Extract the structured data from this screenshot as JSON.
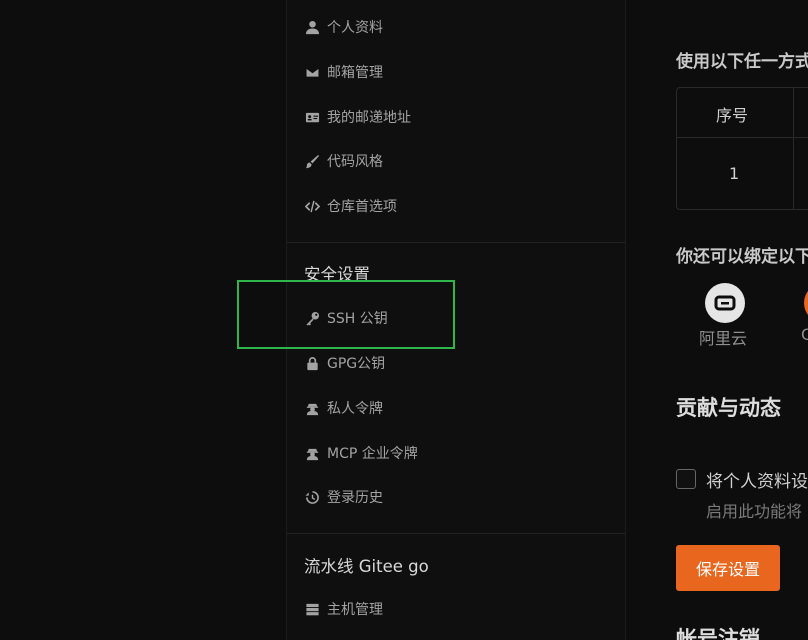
{
  "sidebar": {
    "items_top": [
      {
        "label": "个人资料",
        "icon": "user-icon"
      },
      {
        "label": "邮箱管理",
        "icon": "envelope-icon"
      },
      {
        "label": "我的邮递地址",
        "icon": "address-card-icon"
      },
      {
        "label": "代码风格",
        "icon": "brush-icon"
      },
      {
        "label": "仓库首选项",
        "icon": "code-icon"
      }
    ],
    "security_title": "安全设置",
    "items_security": [
      {
        "label": "SSH 公钥",
        "icon": "key-icon"
      },
      {
        "label": "GPG公钥",
        "icon": "lock-icon"
      },
      {
        "label": "私人令牌",
        "icon": "user-secret-icon"
      },
      {
        "label": "MCP 企业令牌",
        "icon": "user-secret-icon"
      },
      {
        "label": "登录历史",
        "icon": "history-icon"
      }
    ],
    "pipeline_title": "流水线 Gitee go",
    "items_pipeline": [
      {
        "label": "主机管理",
        "icon": "server-icon"
      }
    ]
  },
  "main": {
    "methods_heading": "使用以下任一方式",
    "table": {
      "header_col1": "序号",
      "row1_col1": "1"
    },
    "bind_heading": "你还可以绑定以下",
    "bind_services": [
      {
        "label": "阿里云",
        "icon": "aliyun-icon"
      },
      {
        "label": "G",
        "icon": "gitee-icon"
      }
    ],
    "contrib_heading": "贡献与动态",
    "checkbox_label": "将个人资料设",
    "checkbox_hint": "启用此功能将",
    "save_button": "保存设置",
    "account_heading": "帐号注销"
  },
  "colors": {
    "accent": "#e8661e",
    "highlight": "#2fb64a",
    "background": "#0d0d0d"
  }
}
